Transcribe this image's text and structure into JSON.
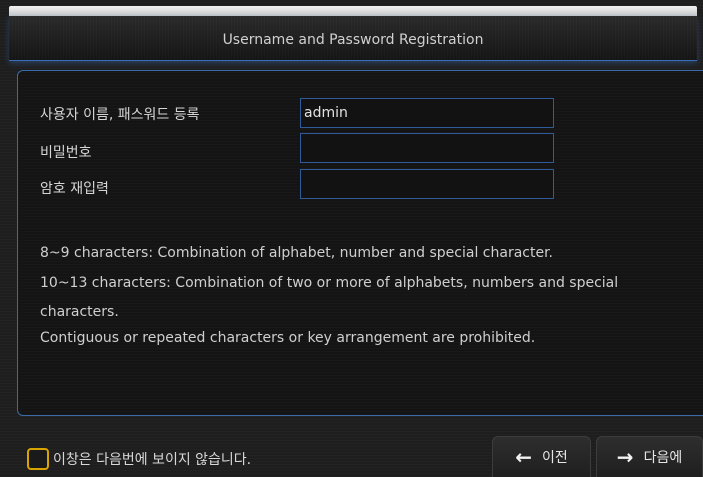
{
  "dialog": {
    "title": "Username and Password Registration"
  },
  "form": {
    "username_label": "사용자 이름, 패스워드 등록",
    "username_value": "admin",
    "password_label": "비밀번호",
    "password_value": "",
    "confirm_label": "암호 재입력",
    "confirm_value": ""
  },
  "rules": [
    "8~9 characters: Combination of alphabet, number and special character.",
    "10~13 characters: Combination of two or more of alphabets, numbers and special",
    "characters.",
    "Contiguous or repeated characters or key arrangement are prohibited."
  ],
  "footer": {
    "dont_show_label": "이창은 다음번에 보이지 않습니다.",
    "dont_show_checked": false,
    "prev_label": "이전",
    "next_label": "다음에"
  },
  "colors": {
    "accent_border": "#3b6aa8",
    "checkbox": "#d7a400"
  },
  "icons": {
    "prev": "left-arrow-icon",
    "next": "right-arrow-icon"
  }
}
